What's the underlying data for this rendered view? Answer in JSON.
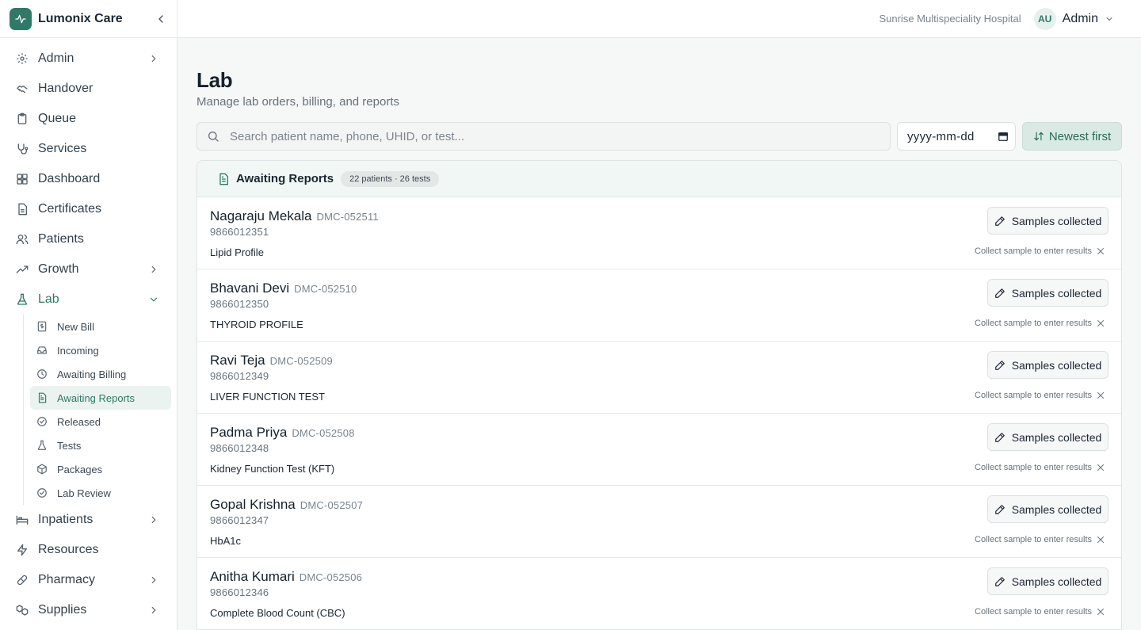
{
  "brand": {
    "name": "Lumonix Care",
    "logo_icon": "activity-icon",
    "accent": "#2f7a66"
  },
  "header": {
    "hospital": "Sunrise Multispeciality Hospital",
    "avatar_initials": "AU",
    "user": "Admin"
  },
  "sidebar": {
    "items": [
      {
        "label": "Admin",
        "icon": "gear-icon",
        "chevron": true
      },
      {
        "label": "Handover",
        "icon": "handshake-icon",
        "chevron": false
      },
      {
        "label": "Queue",
        "icon": "clipboard-icon",
        "chevron": false
      },
      {
        "label": "Services",
        "icon": "stethoscope-icon",
        "chevron": false
      },
      {
        "label": "Dashboard",
        "icon": "dashboard-icon",
        "chevron": false
      },
      {
        "label": "Certificates",
        "icon": "file-icon",
        "chevron": false
      },
      {
        "label": "Patients",
        "icon": "users-icon",
        "chevron": false
      },
      {
        "label": "Growth",
        "icon": "trending-up-icon",
        "chevron": true
      },
      {
        "label": "Lab",
        "icon": "flask-icon",
        "chevron": true,
        "open": true
      },
      {
        "label": "Inpatients",
        "icon": "bed-icon",
        "chevron": true
      },
      {
        "label": "Resources",
        "icon": "zap-icon",
        "chevron": false
      },
      {
        "label": "Pharmacy",
        "icon": "pill-icon",
        "chevron": true
      },
      {
        "label": "Supplies",
        "icon": "boxes-icon",
        "chevron": true
      }
    ],
    "lab_sub": [
      {
        "label": "New Bill",
        "icon": "receipt-icon"
      },
      {
        "label": "Incoming",
        "icon": "inbox-icon"
      },
      {
        "label": "Awaiting Billing",
        "icon": "clock-icon"
      },
      {
        "label": "Awaiting Reports",
        "icon": "file-text-icon",
        "active": true
      },
      {
        "label": "Released",
        "icon": "check-circle-icon"
      },
      {
        "label": "Tests",
        "icon": "flask-icon"
      },
      {
        "label": "Packages",
        "icon": "package-icon"
      },
      {
        "label": "Lab Review",
        "icon": "check-circle-icon"
      }
    ]
  },
  "page": {
    "title": "Lab",
    "subtitle": "Manage lab orders, billing, and reports"
  },
  "toolbar": {
    "search_placeholder": "Search patient name, phone, UHID, or test...",
    "date_placeholder": "yyyy-mm-dd",
    "sort_label": "Newest first"
  },
  "panel": {
    "title": "Awaiting Reports",
    "count": "22 patients · 26 tests"
  },
  "rows": [
    {
      "name": "Nagaraju Mekala",
      "uhid": "DMC-052511",
      "phone": "9866012351",
      "test": "Lipid Profile",
      "action": "Samples collected",
      "hint": "Collect sample to enter results"
    },
    {
      "name": "Bhavani Devi",
      "uhid": "DMC-052510",
      "phone": "9866012350",
      "test": "THYROID PROFILE",
      "action": "Samples collected",
      "hint": "Collect sample to enter results"
    },
    {
      "name": "Ravi Teja",
      "uhid": "DMC-052509",
      "phone": "9866012349",
      "test": "LIVER FUNCTION TEST",
      "action": "Samples collected",
      "hint": "Collect sample to enter results"
    },
    {
      "name": "Padma Priya",
      "uhid": "DMC-052508",
      "phone": "9866012348",
      "test": "Kidney Function Test (KFT)",
      "action": "Samples collected",
      "hint": "Collect sample to enter results"
    },
    {
      "name": "Gopal Krishna",
      "uhid": "DMC-052507",
      "phone": "9866012347",
      "test": "HbA1c",
      "action": "Samples collected",
      "hint": "Collect sample to enter results"
    },
    {
      "name": "Anitha Kumari",
      "uhid": "DMC-052506",
      "phone": "9866012346",
      "test": "Complete Blood Count (CBC)",
      "action": "Samples collected",
      "hint": "Collect sample to enter results"
    }
  ]
}
